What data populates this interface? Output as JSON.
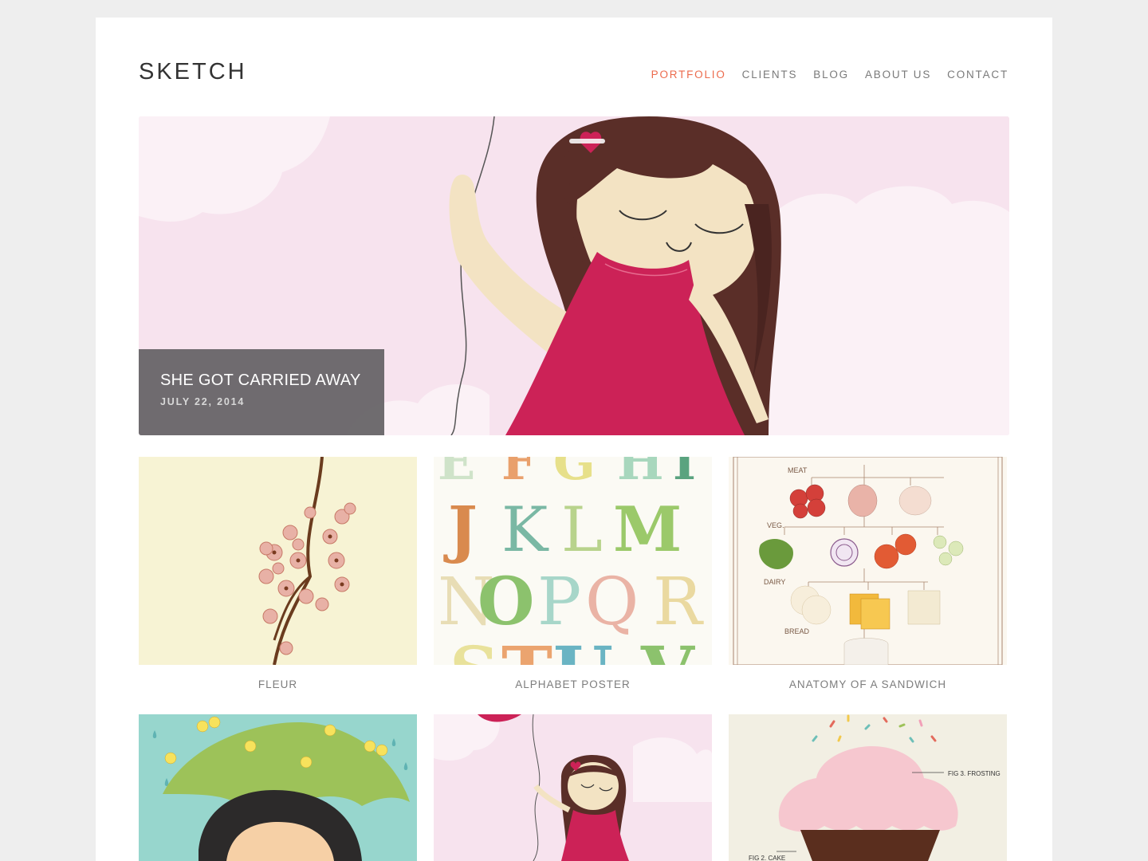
{
  "site": {
    "title": "SKETCH"
  },
  "nav": {
    "items": [
      {
        "label": "PORTFOLIO",
        "active": true
      },
      {
        "label": "CLIENTS"
      },
      {
        "label": "BLOG"
      },
      {
        "label": "ABOUT US"
      },
      {
        "label": "CONTACT"
      }
    ]
  },
  "hero": {
    "title": "SHE GOT CARRIED AWAY",
    "date": "JULY 22, 2014"
  },
  "portfolio": {
    "items": [
      {
        "label": "FLEUR"
      },
      {
        "label": "ALPHABET POSTER"
      },
      {
        "label": "ANATOMY OF A SANDWICH"
      },
      {
        "label": ""
      },
      {
        "label": ""
      },
      {
        "label": ""
      }
    ]
  },
  "alphabet": {
    "row1": [
      "E",
      "F",
      "G",
      "H",
      "I"
    ],
    "row2": [
      "J",
      "K",
      "L",
      "M"
    ],
    "row3": [
      "N",
      "O",
      "P",
      "Q",
      "R"
    ],
    "row4": [
      "S",
      "T",
      "U",
      "V"
    ]
  },
  "sandwich": {
    "meat": "MEAT",
    "veg": "VEG.",
    "dairy": "DAIRY",
    "bread": "BREAD"
  },
  "cupcake": {
    "frosting": "FIG 3. FROSTING",
    "cake": "FIG 2. CAKE"
  },
  "colors": {
    "accent": "#ec6b4d",
    "background": "#eeeeee",
    "caption_bg": "#5f5d60"
  }
}
